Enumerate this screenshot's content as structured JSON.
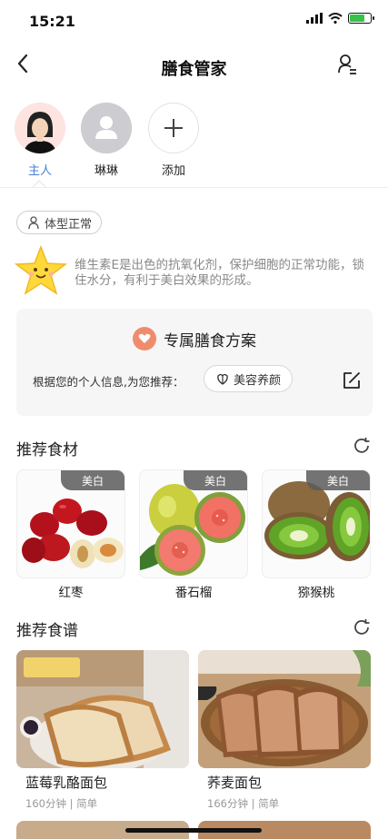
{
  "status_bar": {
    "time": "15:21"
  },
  "nav": {
    "title": "膳食管家"
  },
  "members": [
    {
      "label": "主人",
      "color": "#4a7fd6"
    },
    {
      "label": "琳琳",
      "color": "#222222"
    },
    {
      "label": "添加",
      "color": "#222222"
    }
  ],
  "body_tag": {
    "label": "体型正常"
  },
  "tip": {
    "text": "维生素E是出色的抗氧化剂，保护细胞的正常功能，锁住水分，有利于美白效果的形成。"
  },
  "plan": {
    "title": "专属膳食方案",
    "desc": "根据您的个人信息,为您推荐：",
    "tag": "美容养颜"
  },
  "recommended_ingredients": {
    "title": "推荐食材",
    "items": [
      {
        "name": "红枣",
        "badge": "美白"
      },
      {
        "name": "番石榴",
        "badge": "美白"
      },
      {
        "name": "猕猴桃",
        "badge": "美白"
      }
    ]
  },
  "recommended_recipes": {
    "title": "推荐食谱",
    "items": [
      {
        "name": "蓝莓乳酪面包",
        "meta": "160分钟 | 简单"
      },
      {
        "name": "荞麦面包",
        "meta": "166分钟 | 简单"
      }
    ]
  },
  "colors": {
    "accent": "#4a7fd6",
    "badge_bg": "#5a5a5a",
    "battery": "#36c34a",
    "heart": "#f08c6e"
  }
}
